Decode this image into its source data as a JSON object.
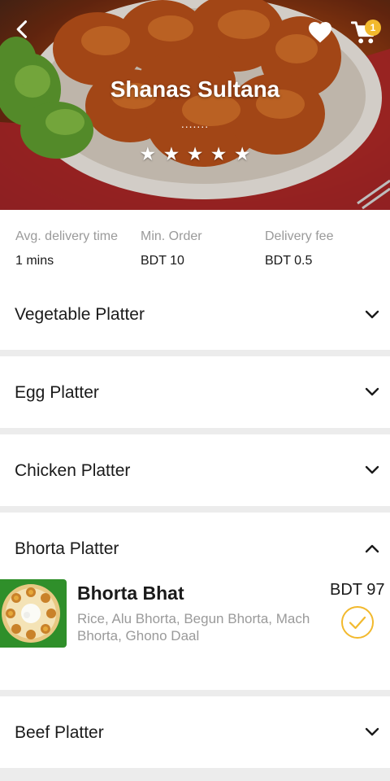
{
  "header": {
    "restaurant_name": "Shanas Sultana",
    "dots": ".......",
    "rating_stars": 5,
    "cart_count": "1",
    "icons": {
      "back": "back-arrow-icon",
      "favorite": "heart-icon",
      "cart": "cart-icon"
    }
  },
  "info": [
    {
      "label": "Avg. delivery time",
      "value": "1 mins"
    },
    {
      "label": "Min. Order",
      "value": "BDT 10"
    },
    {
      "label": "Delivery fee",
      "value": "BDT 0.5"
    }
  ],
  "sections": [
    {
      "title": "Vegetable Platter",
      "expanded": false
    },
    {
      "title": "Egg Platter",
      "expanded": false
    },
    {
      "title": "Chicken Platter",
      "expanded": false
    },
    {
      "title": "Bhorta Platter",
      "expanded": true,
      "items": [
        {
          "name": "Bhorta Bhat",
          "description": "Rice, Alu Bhorta, Begun Bhorta, Mach Bhorta, Ghono Daal",
          "price": "BDT 97",
          "selected": true
        }
      ]
    },
    {
      "title": "Beef Platter",
      "expanded": false
    }
  ],
  "colors": {
    "accent": "#f2b92d",
    "muted_text": "#9a9a9a",
    "text": "#1a1a1a",
    "divider": "#ececec"
  }
}
